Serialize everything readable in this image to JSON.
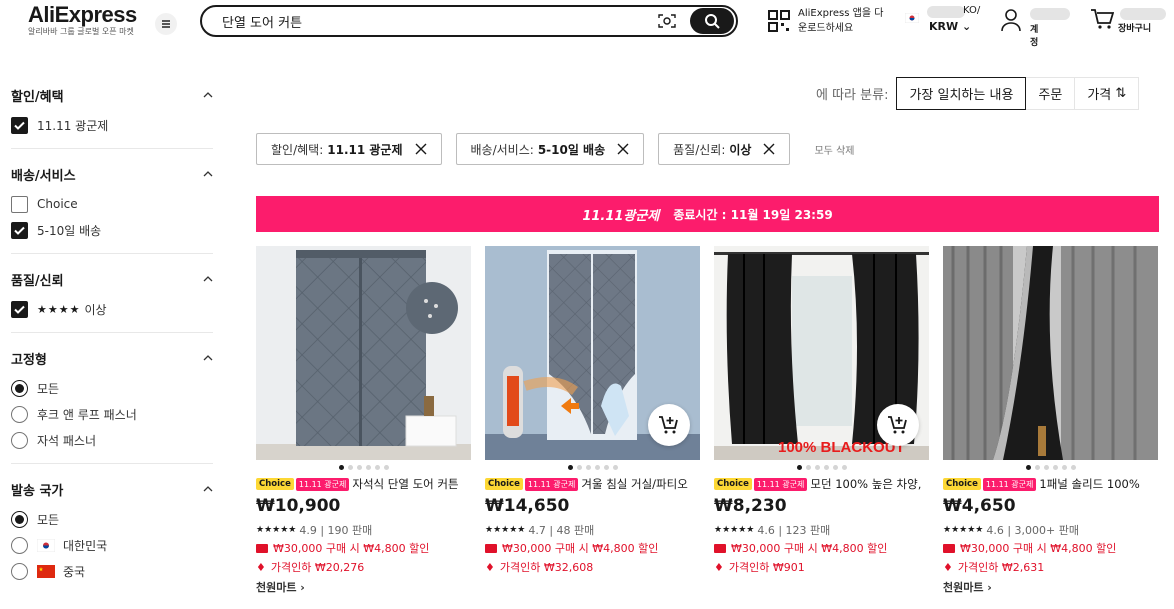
{
  "header": {
    "logo": "AliExpress",
    "logo_sub": "알리바바 그룹 글로벌 오픈 마켓",
    "search_value": "단열 도어 커튼",
    "app_download": [
      "AliExpress 앱을 다",
      "운로드하세요"
    ],
    "locale_suffix": "KO/",
    "currency": "KRW",
    "account_label": "계정",
    "cart_label": "장바구니"
  },
  "sort": {
    "label": "에 따라 분류:",
    "options": [
      "가장 일치하는 내용",
      "주문",
      "가격"
    ]
  },
  "chips": [
    {
      "key": "할인/혜택:",
      "value": "11.11 광군제"
    },
    {
      "key": "배송/서비스:",
      "value": "5-10일 배송"
    },
    {
      "key": "품질/신뢰:",
      "value": "이상"
    }
  ],
  "clear_all": "모두 삭제",
  "banner": {
    "brand": "11.11광군제",
    "text": "종료시간 : 11월 19일 23:59"
  },
  "filters": [
    {
      "title": "할인/혜택",
      "type": "checkbox",
      "options": [
        {
          "label": "11.11 광군제",
          "checked": true
        }
      ]
    },
    {
      "title": "배송/서비스",
      "type": "checkbox",
      "options": [
        {
          "label": "Choice",
          "checked": false
        },
        {
          "label": "5-10일 배송",
          "checked": true
        }
      ]
    },
    {
      "title": "품질/신뢰",
      "type": "checkbox",
      "options": [
        {
          "label": "이상",
          "checked": true,
          "stars": "★★★★"
        }
      ]
    },
    {
      "title": "고정형",
      "type": "radio",
      "options": [
        {
          "label": "모든",
          "checked": true
        },
        {
          "label": "후크 앤 루프 패스너",
          "checked": false
        },
        {
          "label": "자석 패스너",
          "checked": false
        }
      ]
    },
    {
      "title": "발송 국가",
      "type": "radio",
      "options": [
        {
          "label": "모든",
          "checked": true
        },
        {
          "label": "대한민국",
          "checked": false,
          "flag": "kr"
        },
        {
          "label": "중국",
          "checked": false,
          "flag": "cn"
        }
      ]
    }
  ],
  "products": [
    {
      "title": "자석식 단열 도어 커튼",
      "price": "₩10,900",
      "rating": "4.9",
      "sold": "190 판매",
      "coupon": "₩30,000 구매 시 ₩4,800 할인",
      "price_drop": "가격인하 ₩20,276",
      "store": "천원마트 ›",
      "choice": "Choice",
      "sale": "11.11 광군제",
      "stars": "★★★★★",
      "cart_fab": false
    },
    {
      "title": "겨울 침실 거실/파티오",
      "price": "₩14,650",
      "rating": "4.7",
      "sold": "48 판매",
      "coupon": "₩30,000 구매 시 ₩4,800 할인",
      "price_drop": "가격인하 ₩32,608",
      "store": "",
      "choice": "Choice",
      "sale": "11.11 광군제",
      "stars": "★★★★★",
      "cart_fab": true
    },
    {
      "title": "모던 100% 높은 차양,",
      "price": "₩8,230",
      "rating": "4.6",
      "sold": "123 판매",
      "coupon": "₩30,000 구매 시 ₩4,800 할인",
      "price_drop": "가격인하 ₩901",
      "store": "",
      "choice": "Choice",
      "sale": "11.11 광군제",
      "stars": "★★★★★",
      "cart_fab": true,
      "img_label": "100% BLACKOUT"
    },
    {
      "title": "1패널 솔리드 100%",
      "price": "₩4,650",
      "rating": "4.6",
      "sold": "3,000+ 판매",
      "coupon": "₩30,000 구매 시 ₩4,800 할인",
      "price_drop": "가격인하 ₩2,631",
      "store": "천원마트 ›",
      "choice": "Choice",
      "sale": "11.11 광군제",
      "stars": "★★★★★",
      "cart_fab": false
    }
  ],
  "colors": {
    "accent": "#fc1c6c",
    "choice": "#fdd835",
    "promo_text": "#e0112a"
  }
}
